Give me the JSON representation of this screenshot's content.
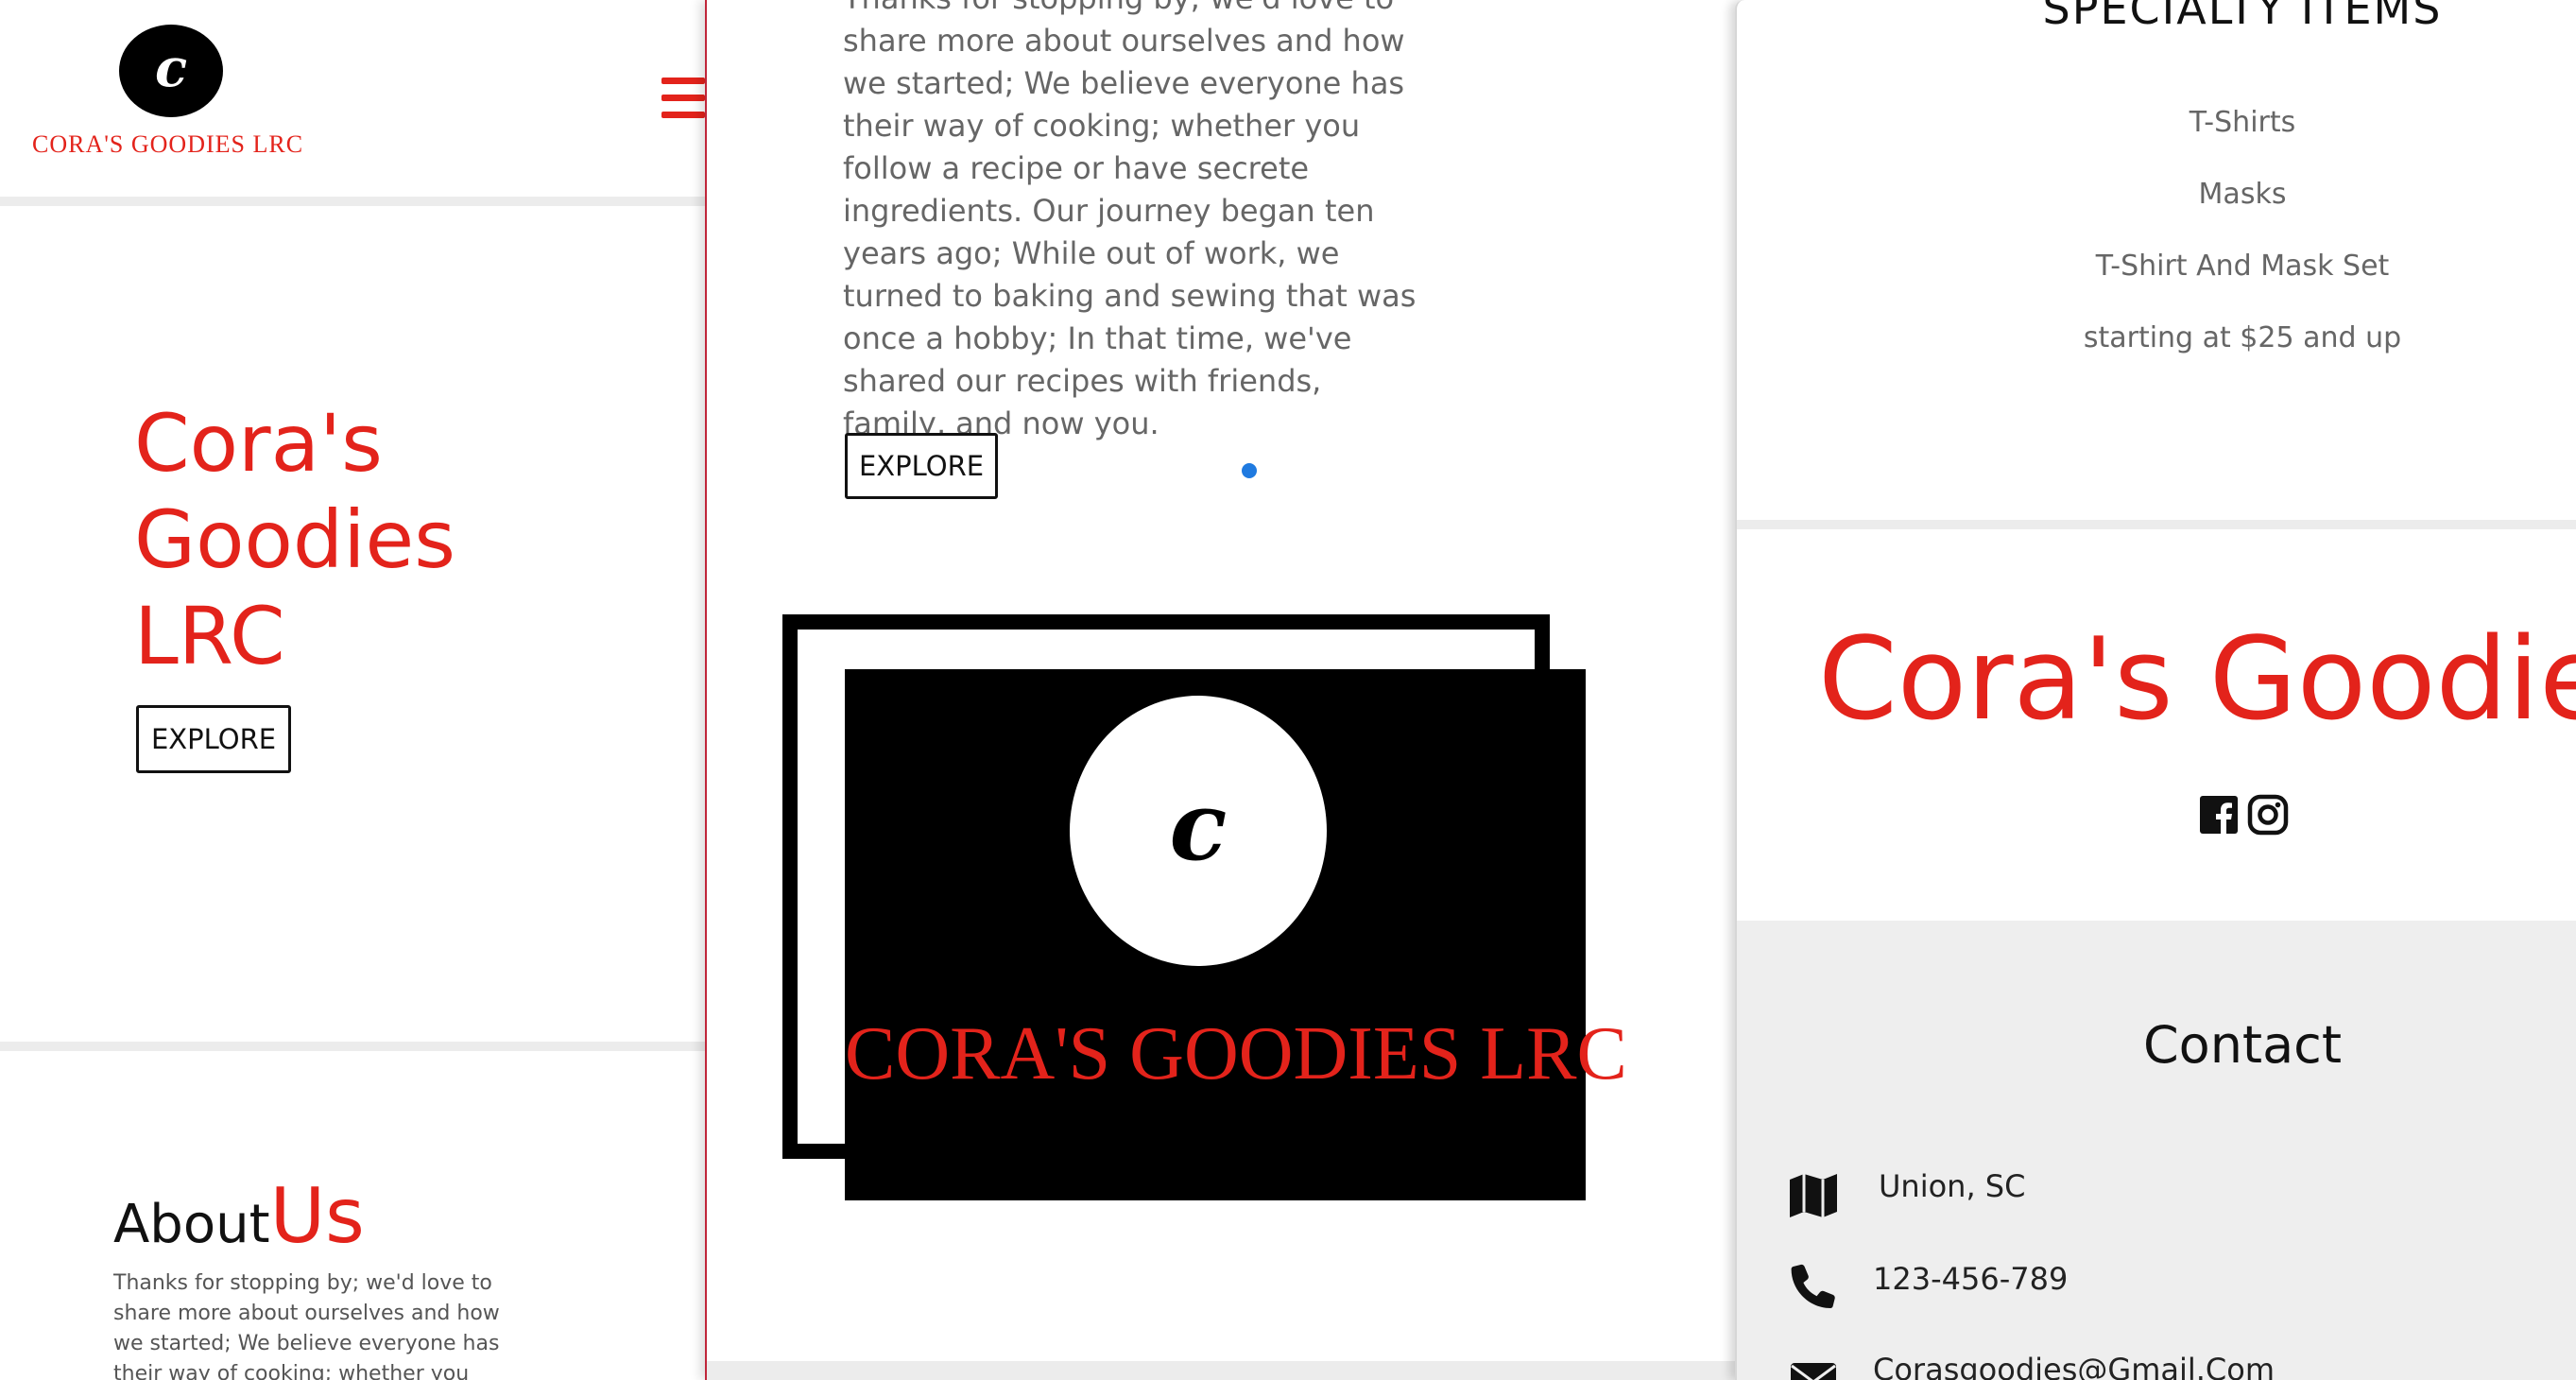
{
  "left_panel": {
    "logo_letter": "c",
    "logo_text": "CORA'S GOODIES LRC",
    "hero_lines": [
      "Cora's",
      "Goodies",
      "LRC"
    ],
    "explore_label": "EXPLORE",
    "about_heading_part1": "About",
    "about_heading_part2": "Us",
    "about_text": "Thanks for stopping by; we'd love to share more about ourselves and how we started; We believe everyone has their way of cooking; whether you follow"
  },
  "middle_panel": {
    "body_text": "Thanks for stopping by; we'd love to share more about ourselves and how we started; We believe everyone has their way of cooking; whether you follow a recipe or have secrete ingredients. Our journey began ten years ago; While out of work, we turned to baking and sewing that was once a hobby; In that time, we've shared our recipes with friends, family, and now you.",
    "explore_label": "EXPLORE",
    "card_letter": "c",
    "card_text": "CORA'S GOODIES LRC"
  },
  "right_panel": {
    "specialty_title": "SPECIALTY ITEMS",
    "specialty_items": [
      "T-Shirts",
      "Masks",
      "T-Shirt And Mask Set",
      "starting at $25 and up"
    ],
    "brand_name": "Cora's Goodies",
    "contact_title": "Contact",
    "contact": {
      "location": "Union, SC",
      "phone": "123-456-789",
      "email": "Corasgoodies@Gmail.Com"
    }
  },
  "colors": {
    "brand_red": "#e3231b",
    "text_gray": "#666666",
    "contact_bg": "#eeeeee",
    "dot_blue": "#1f7ae0"
  },
  "icons": [
    "hamburger-menu-icon",
    "facebook-icon",
    "instagram-icon",
    "map-icon",
    "phone-icon",
    "envelope-icon"
  ]
}
